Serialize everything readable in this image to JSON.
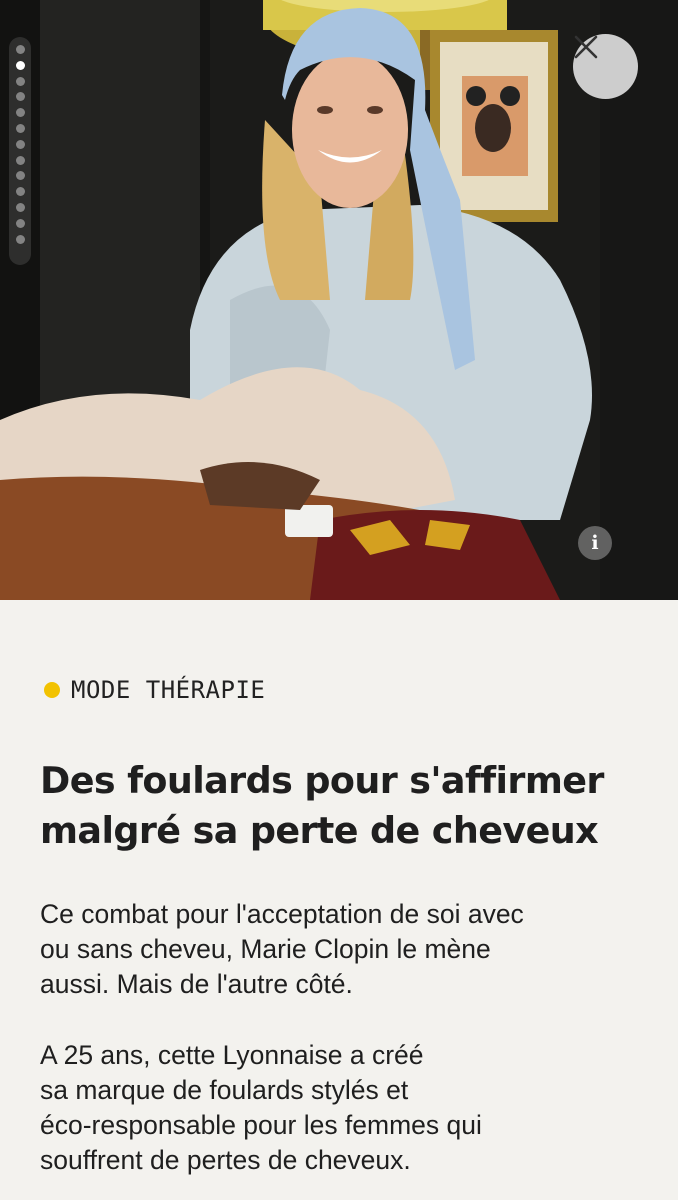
{
  "story": {
    "progress_total": 13,
    "progress_active_index": 1,
    "close_icon": "close-icon",
    "info_icon": "info-icon",
    "info_label": "i"
  },
  "article": {
    "category": "MODE THÉRAPIE",
    "category_color": "#f2c200",
    "headline_line1": "Des foulards pour s'affirmer",
    "headline_line2": "malgré sa perte de cheveux",
    "para1_line1": "Ce combat pour l'acceptation de soi avec",
    "para1_line2": "ou sans cheveu, Marie Clopin le mène",
    "para1_line3": "aussi. Mais de l'autre côté.",
    "para2_line1": "A 25 ans, cette Lyonnaise a créé",
    "para2_line2": "sa marque de foulards stylés et",
    "para2_line3": "éco-responsable pour les femmes qui",
    "para2_line4": "souffrent de pertes de cheveux."
  }
}
